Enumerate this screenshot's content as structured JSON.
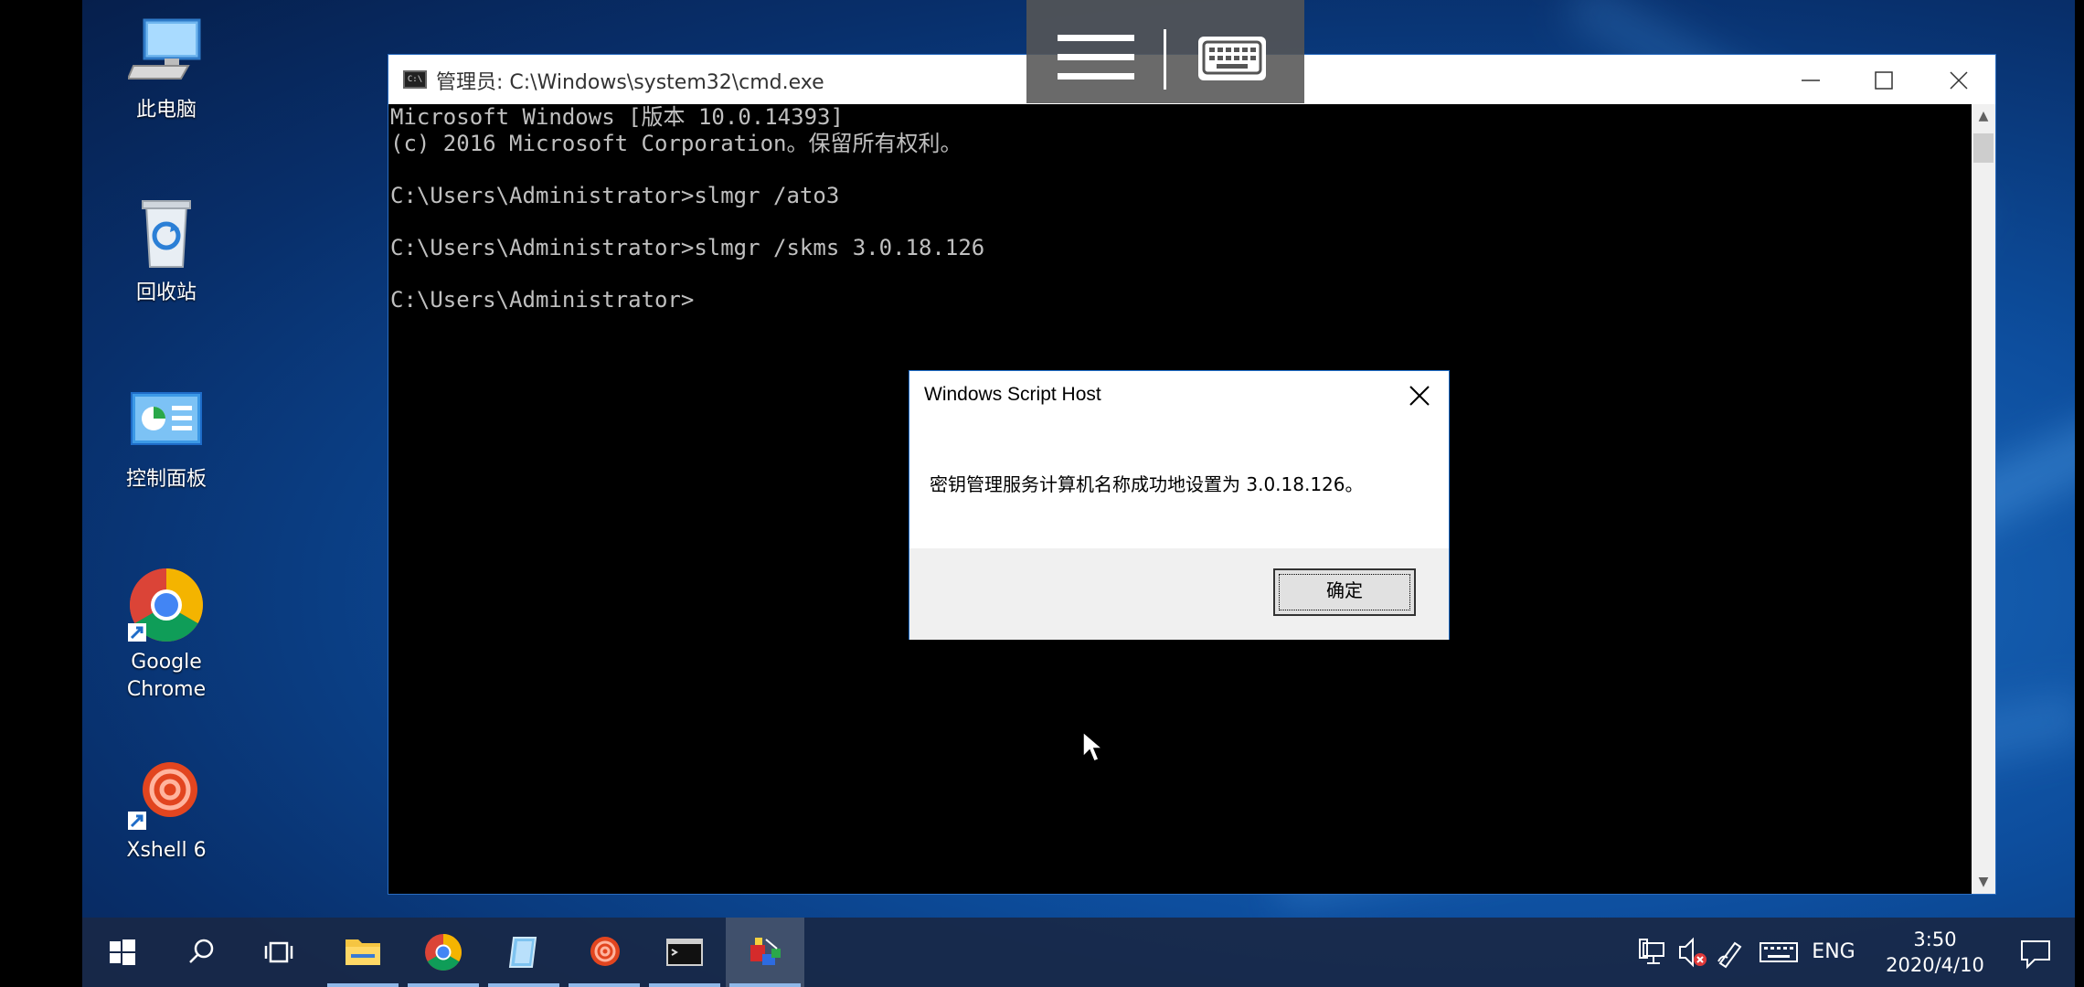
{
  "desktop": {
    "icons": [
      {
        "label": "此电脑"
      },
      {
        "label": "回收站"
      },
      {
        "label": "控制面板"
      },
      {
        "label": "Google\nChrome"
      },
      {
        "label": "Xshell 6"
      }
    ]
  },
  "cmd_window": {
    "title": "管理员: C:\\Windows\\system32\\cmd.exe",
    "lines": [
      "Microsoft Windows [版本 10.0.14393]",
      "(c) 2016 Microsoft Corporation。保留所有权利。",
      "",
      "C:\\Users\\Administrator>slmgr /ato3",
      "",
      "C:\\Users\\Administrator>slmgr /skms 3.0.18.126",
      "",
      "C:\\Users\\Administrator>"
    ]
  },
  "dialog": {
    "title": "Windows Script Host",
    "message": "密钥管理服务计算机名称成功地设置为 3.0.18.126。",
    "ok_label": "确定"
  },
  "taskbar": {
    "language": "ENG",
    "time": "3:50",
    "date": "2020/4/10"
  },
  "colors": {
    "accent": "#1e6cc8",
    "console_text": "#c0c0c0",
    "taskbar": "#192846"
  }
}
